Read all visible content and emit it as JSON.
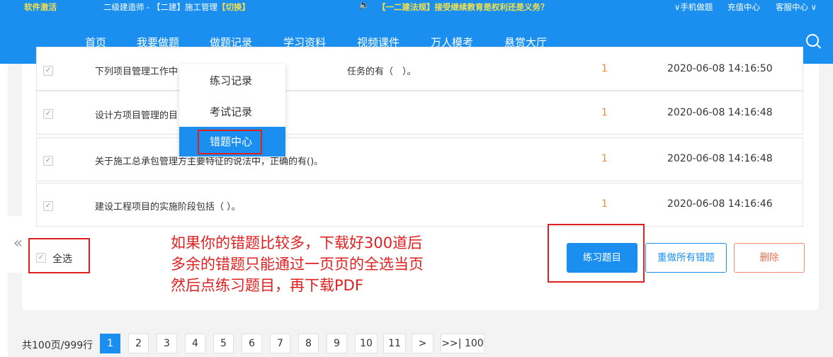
{
  "topbar": {
    "activate": "软件激活",
    "exam": "二级建造师 - ",
    "course": "【二建】施工管理",
    "switch": "【切换】",
    "speaker_icon": "speaker-icon",
    "notice": "【一二建法规】接受继续教育是权利还是义务？",
    "mobile": "∨手机做题",
    "recharge": "充值中心",
    "service": "客服中心 ∨"
  },
  "nav": [
    "首页",
    "我要做题",
    "做题记录",
    "学习资料",
    "视频课件",
    "万人模考",
    "悬赏大厅"
  ],
  "dropdown": [
    "练习记录",
    "考试记录",
    "错题中心"
  ],
  "rows": [
    {
      "title": "下列项目管理工作中",
      "title_tail": "任务的有（　）。",
      "count": "1",
      "time": "2020-06-08 14:16:50"
    },
    {
      "title": "设计方项目管理的目",
      "title_tail": "",
      "count": "1",
      "time": "2020-06-08 14:16:48"
    },
    {
      "title": "关于施工总承包管理方主要特征的说法中，正确的有()。",
      "title_tail": "",
      "count": "1",
      "time": "2020-06-08 14:16:48"
    },
    {
      "title": "建设工程项目的实施阶段包括（ ）。",
      "title_tail": "",
      "count": "1",
      "time": "2020-06-08 14:16:46"
    }
  ],
  "select_all": "全选",
  "note_lines": [
    "如果你的错题比较多，下载好300道后",
    "多余的错题只能通过一页页的全选当页",
    "然后点练习题目，再下载PDF"
  ],
  "buttons": {
    "practice": "练习题目",
    "redo": "重做所有错题",
    "delete": "删除"
  },
  "pager": {
    "summary": "共100页/999行",
    "pages": [
      "1",
      "2",
      "3",
      "4",
      "5",
      "6",
      "7",
      "8",
      "9",
      "10",
      "11"
    ],
    "next": ">",
    "last": ">>| 100",
    "current": "1"
  },
  "colors": {
    "brand": "#1a8ff0",
    "highlight": "#e02020",
    "count": "#f08a3c",
    "notice": "#f5e04a"
  }
}
